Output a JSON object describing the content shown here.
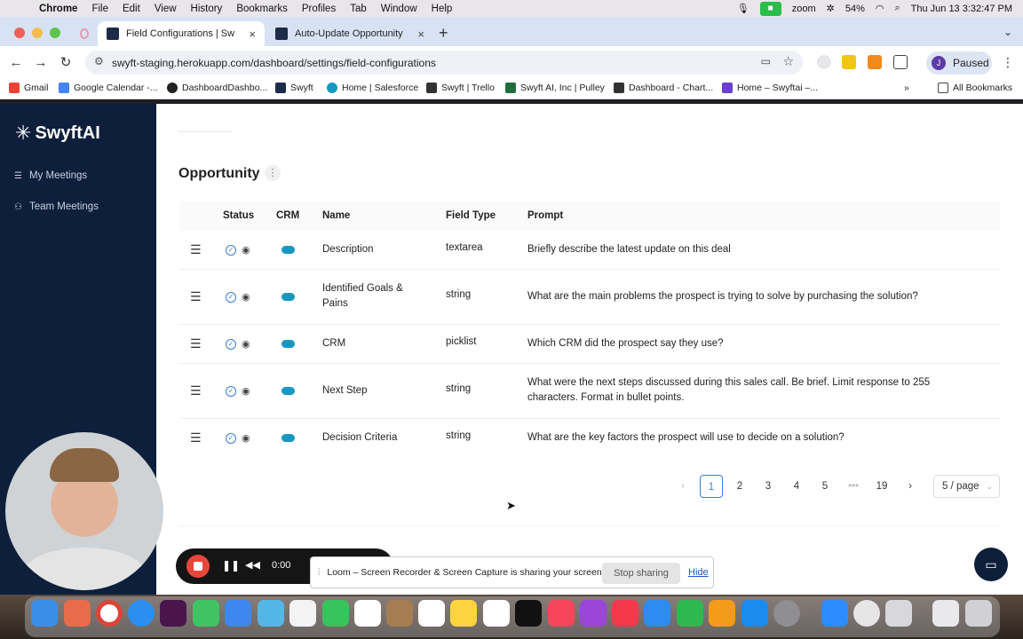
{
  "menubar": {
    "app": "Chrome",
    "items": [
      "File",
      "Edit",
      "View",
      "History",
      "Bookmarks",
      "Profiles",
      "Tab",
      "Window",
      "Help"
    ],
    "zoom_label": "zoom",
    "battery": "54%",
    "datetime": "Thu Jun 13  3:32:47 PM"
  },
  "browser": {
    "tabs": [
      {
        "title": "Field Configurations | Swyft"
      },
      {
        "title": "Auto-Update Opportunity in C"
      }
    ],
    "url": "swyft-staging.herokuapp.com/dashboard/settings/field-configurations",
    "profile_initial": "J",
    "profile_status": "Paused",
    "bookmarks": [
      "Gmail",
      "Google Calendar -...",
      "DashboardDashbo...",
      "Swyft",
      "Home | Salesforce",
      "Swyft | Trello",
      "Swyft AI, Inc | Pulley",
      "Dashboard - Chart...",
      "Home – Swyftai –..."
    ],
    "all_bookmarks": "All Bookmarks"
  },
  "sidebar": {
    "logo": "SwyftAI",
    "items": [
      {
        "label": "My Meetings"
      },
      {
        "label": "Team Meetings"
      }
    ]
  },
  "main": {
    "section_title": "Opportunity",
    "columns": {
      "status": "Status",
      "crm": "CRM",
      "name": "Name",
      "field_type": "Field Type",
      "prompt": "Prompt"
    },
    "rows": [
      {
        "name": "Description",
        "field_type": "textarea",
        "prompt": "Briefly describe the latest update on this deal"
      },
      {
        "name": "Identified Goals & Pains",
        "field_type": "string",
        "prompt": "What are the main problems the prospect is trying to solve by purchasing the solution?"
      },
      {
        "name": "CRM",
        "field_type": "picklist",
        "prompt": "Which CRM did the prospect say they use?"
      },
      {
        "name": "Next Step",
        "field_type": "string",
        "prompt": "What were the next steps discussed during this sales call. Be brief. Limit response to 255 characters. Format in bullet points."
      },
      {
        "name": "Decision Criteria",
        "field_type": "string",
        "prompt": "What are the key factors the prospect will use to decide on a solution?"
      }
    ],
    "pagination": {
      "prev": "‹",
      "pages": [
        "1",
        "2",
        "3",
        "4",
        "5"
      ],
      "ellipsis": "•••",
      "last": "19",
      "next": "›",
      "current": "1",
      "page_size": "5 / page"
    }
  },
  "loom": {
    "timer": "0:00",
    "share_message": "Loom – Screen Recorder & Screen Capture is sharing your screen.",
    "stop_label": "Stop sharing",
    "hide_label": "Hide"
  },
  "colors": {
    "sidebar_bg": "#0e1f3c",
    "accent": "#3a7bd5",
    "salesforce": "#1798c1",
    "record": "#e5483a"
  }
}
